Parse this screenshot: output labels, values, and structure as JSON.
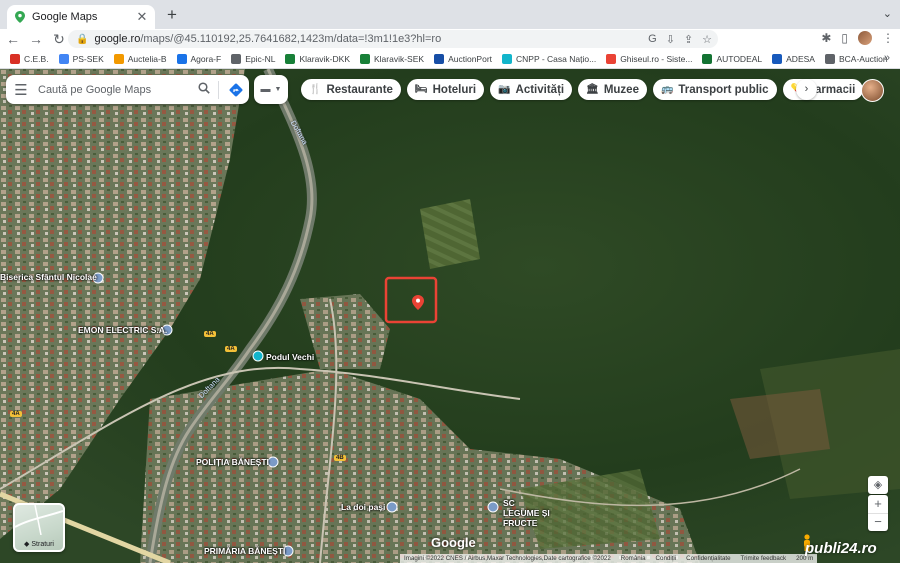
{
  "browser": {
    "tab_title": "Google Maps",
    "tab_close": "✕",
    "new_tab": "+",
    "tab_menu": "⌄",
    "url_host": "google.ro",
    "url_path": "/maps/@45.110192,25.7641682,1423m/data=!3m1!1e3?hl=ro",
    "bookmarks": [
      {
        "label": "C.E.B.",
        "color": "#d93025"
      },
      {
        "label": "PS-SEK",
        "color": "#4285f4"
      },
      {
        "label": "Auctelia-B",
        "color": "#f29900"
      },
      {
        "label": "Agora-F",
        "color": "#1a73e8"
      },
      {
        "label": "Epic-NL",
        "color": "#5f6368"
      },
      {
        "label": "Klaravik-DKK",
        "color": "#188038"
      },
      {
        "label": "Klaravik-SEK",
        "color": "#188038"
      },
      {
        "label": "AuctionPort",
        "color": "#174ea6"
      },
      {
        "label": "CNPP - Casa Națio...",
        "color": "#12b5cb"
      },
      {
        "label": "Ghiseul.ro - Siste...",
        "color": "#ea4335"
      },
      {
        "label": "AUTODEAL",
        "color": "#137333"
      },
      {
        "label": "ADESA",
        "color": "#185abc"
      },
      {
        "label": "BCA-Auction",
        "color": "#5f6368"
      }
    ],
    "bookmarks_more": "»"
  },
  "maps": {
    "search_placeholder": "Caută pe Google Maps",
    "chips": [
      {
        "label": "Restaurante",
        "icon": "🍴"
      },
      {
        "label": "Hoteluri",
        "icon": "🛏"
      },
      {
        "label": "Activități",
        "icon": "📷"
      },
      {
        "label": "Muzee",
        "icon": "🏛"
      },
      {
        "label": "Transport public",
        "icon": "🚌"
      },
      {
        "label": "Farmacii",
        "icon": "💊"
      }
    ],
    "chip_next": "›",
    "place_labels": {
      "biserica": "Biserica Sfântul Nicolae",
      "emon": "EMON ELECTRIC S.A.",
      "podul": "Podul Vechi",
      "politia": "POLIȚIA BĂNEȘTI",
      "ladoi": "La doi pași",
      "legume": "SC LEGUME ȘI FRUCTE",
      "primaria": "PRIMĂRIA BĂNEȘTI"
    },
    "river_labels": [
      "Doftana",
      "Doftana"
    ],
    "road_shields": [
      "4A",
      "4A",
      "4A",
      "4B"
    ],
    "layers_label": "Straturi",
    "google_logo": "Google",
    "attribution": [
      "Imagini ©2022 CNES / Airbus,Maxar Technologies,Date cartografice ©2022",
      "România",
      "Condiții",
      "Confidențialitate",
      "Trimite feedback",
      "200 m"
    ],
    "zoom_in": "+",
    "zoom_out": "−",
    "watermark": "publi24.ro"
  }
}
